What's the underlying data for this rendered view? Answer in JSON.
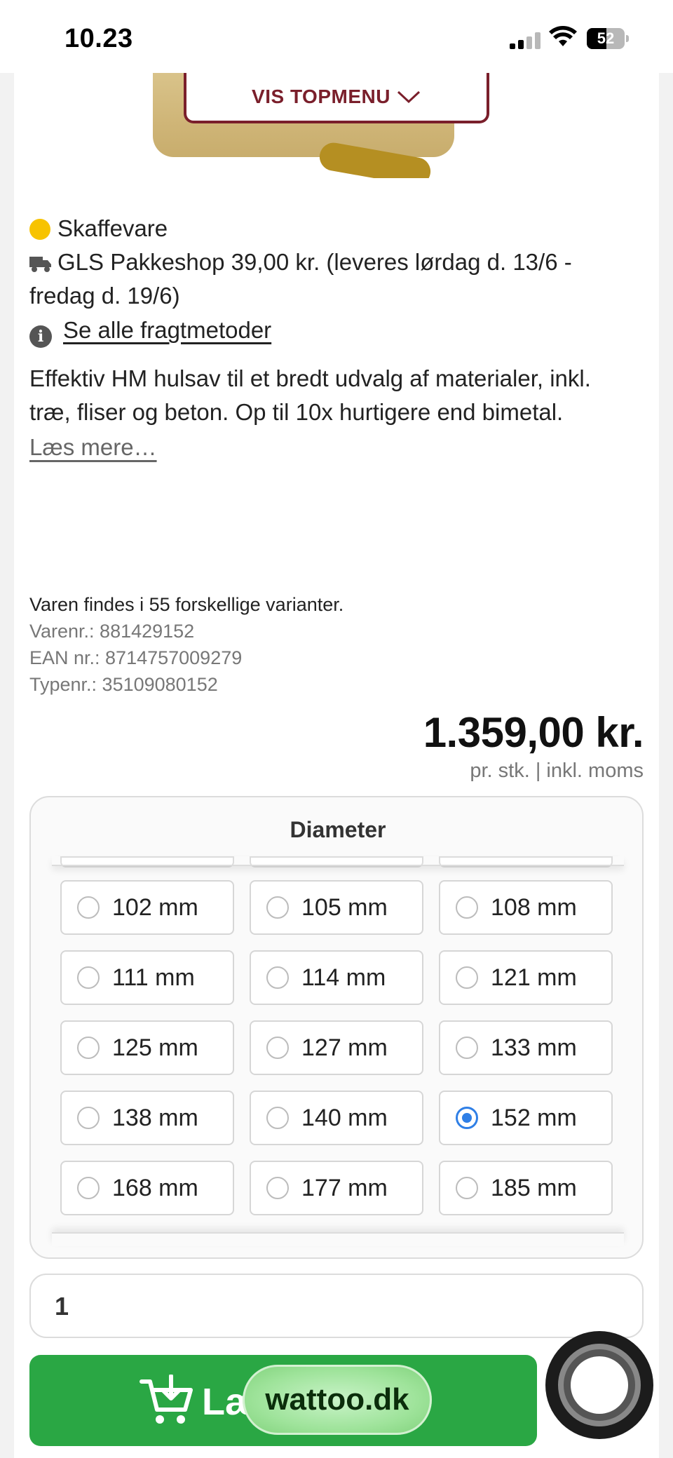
{
  "status_bar": {
    "time": "10.23",
    "battery": "52"
  },
  "top_menu": {
    "label": "VIS TOPMENU"
  },
  "product": {
    "stock_status": "Skaffevare",
    "shipping_line1": "GLS Pakkeshop 39,00 kr. (leveres lørdag d. 13/6 -",
    "shipping_line2": "fredag d. 19/6)",
    "all_shipping_link": "Se alle fragtmetoder",
    "description_line1": "Effektiv HM hulsav til et bredt udvalg af materialer, inkl.",
    "description_line2": "træ, fliser og beton. Op til 10x hurtigere end bimetal.",
    "read_more": "Læs mere…",
    "variants_info": "Varen findes i 55 forskellige varianter.",
    "item_number": "Varenr.: 881429152",
    "ean_number": "EAN nr.: 8714757009279",
    "type_number": "Typenr.: 35109080152",
    "price": "1.359,00 kr.",
    "price_note": "pr. stk. | inkl. moms"
  },
  "variant_selector": {
    "title": "Diameter",
    "options": [
      {
        "label": "102 mm",
        "selected": false
      },
      {
        "label": "105 mm",
        "selected": false
      },
      {
        "label": "108 mm",
        "selected": false
      },
      {
        "label": "111 mm",
        "selected": false
      },
      {
        "label": "114 mm",
        "selected": false
      },
      {
        "label": "121 mm",
        "selected": false
      },
      {
        "label": "125 mm",
        "selected": false
      },
      {
        "label": "127 mm",
        "selected": false
      },
      {
        "label": "133 mm",
        "selected": false
      },
      {
        "label": "138 mm",
        "selected": false
      },
      {
        "label": "140 mm",
        "selected": false
      },
      {
        "label": "152 mm",
        "selected": true
      },
      {
        "label": "168 mm",
        "selected": false
      },
      {
        "label": "177 mm",
        "selected": false
      },
      {
        "label": "185 mm",
        "selected": false
      }
    ]
  },
  "quantity": {
    "value": "1"
  },
  "cart_button": {
    "label": "Læ"
  },
  "overlay_badge": {
    "label": "wattoo.dk"
  },
  "colors": {
    "brand_red": "#7a1f2b",
    "cart_green": "#2aa744",
    "stock_yellow": "#f7c300",
    "radio_blue": "#2f7fe6"
  },
  "icons": [
    "truck-icon",
    "info-icon",
    "chevron-down-icon",
    "cart-add-icon",
    "chat-icon",
    "wifi-icon",
    "signal-icon",
    "battery-icon"
  ]
}
